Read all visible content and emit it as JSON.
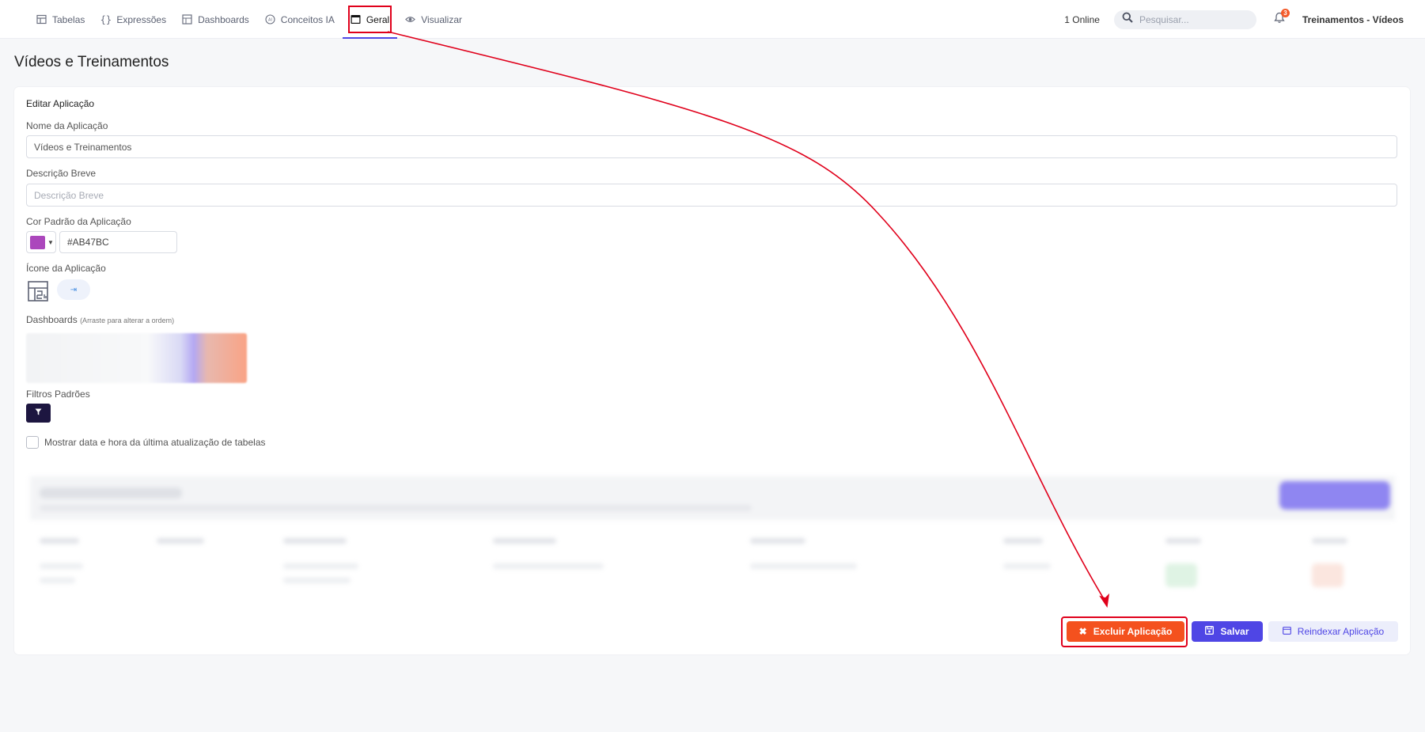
{
  "nav": {
    "items": [
      {
        "label": "Tabelas",
        "icon": "table-icon"
      },
      {
        "label": "Expressões",
        "icon": "braces-icon"
      },
      {
        "label": "Dashboards",
        "icon": "dashboard-icon"
      },
      {
        "label": "Conceitos IA",
        "icon": "ai-icon"
      },
      {
        "label": "Geral",
        "icon": "window-icon"
      },
      {
        "label": "Visualizar",
        "icon": "eye-icon"
      }
    ],
    "active": "Geral"
  },
  "header": {
    "online": "1 Online",
    "search_placeholder": "Pesquisar...",
    "notification_count": "3",
    "user": "Treinamentos - Vídeos"
  },
  "page": {
    "title": "Vídeos e Treinamentos"
  },
  "form": {
    "section_title": "Editar Aplicação",
    "name_label": "Nome da Aplicação",
    "name_value": "Vídeos e Treinamentos",
    "description_label": "Descrição Breve",
    "description_placeholder": "Descrição Breve",
    "color_label": "Cor Padrão da Aplicação",
    "color_value": "#AB47BC",
    "icon_label": "Ícone da Aplicação",
    "dashboards_label": "Dashboards",
    "dashboards_hint": "(Arraste para alterar a ordem)",
    "filters_label": "Filtros Padrões",
    "checkbox_label": "Mostrar data e hora da última atualização de tabelas",
    "checkbox_checked": false
  },
  "actions": {
    "delete_label": "Excluir Aplicação",
    "save_label": "Salvar",
    "reindex_label": "Reindexar Aplicação"
  },
  "colors": {
    "accent": "#4f46e5",
    "danger": "#f4511e",
    "annotation": "#e0001b",
    "app_color": "#AB47BC"
  }
}
